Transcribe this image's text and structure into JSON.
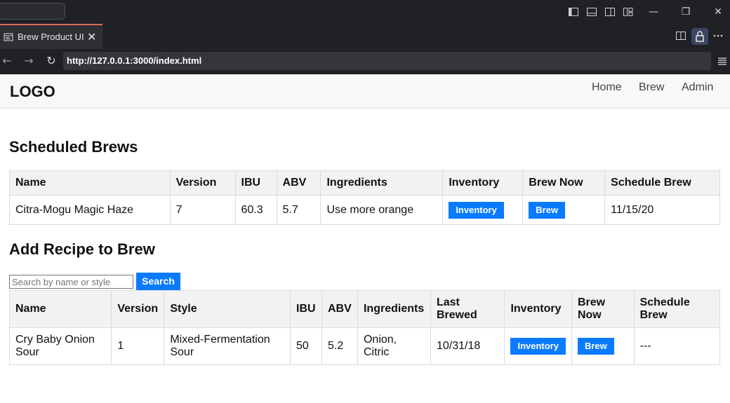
{
  "browser": {
    "tab_title": "Brew Product UI",
    "tab_close": "✕",
    "url": "http://127.0.0.1:3000/index.html"
  },
  "site": {
    "logo": "LOGO",
    "nav": [
      "Home",
      "Brew",
      "Admin"
    ]
  },
  "scheduled": {
    "heading": "Scheduled Brews",
    "headers": [
      "Name",
      "Version",
      "IBU",
      "ABV",
      "Ingredients",
      "Inventory",
      "Brew Now",
      "Schedule Brew"
    ],
    "rows": [
      {
        "name": "Citra-Mogu Magic Haze",
        "version": "7",
        "ibu": "60.3",
        "abv": "5.7",
        "ingredients": "Use more orange",
        "inventory_btn": "Inventory",
        "brew_btn": "Brew",
        "schedule": "11/15/20"
      }
    ]
  },
  "add_recipe": {
    "heading": "Add Recipe to Brew",
    "search_placeholder": "Search by name or style",
    "search_button": "Search",
    "headers": [
      "Name",
      "Version",
      "Style",
      "IBU",
      "ABV",
      "Ingredients",
      "Last Brewed",
      "Inventory",
      "Brew Now",
      "Schedule Brew"
    ],
    "rows": [
      {
        "name": "Cry Baby Onion Sour",
        "version": "1",
        "style": "Mixed-Fermentation Sour",
        "ibu": "50",
        "abv": "5.2",
        "ingredients": "Onion, Citric",
        "last_brewed": "10/31/18",
        "inventory_btn": "Inventory",
        "brew_btn": "Brew",
        "schedule": "---"
      }
    ]
  },
  "colors": {
    "primary_button": "#0a7bff",
    "chrome_bg": "#202124",
    "header_bg": "#f8f8f8"
  }
}
